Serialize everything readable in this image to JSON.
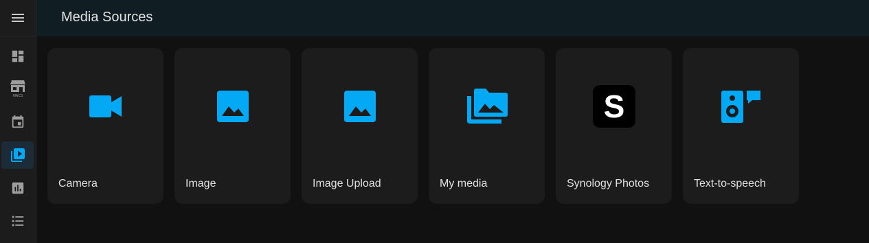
{
  "header": {
    "title": "Media Sources"
  },
  "sidebar": {
    "menu_icon": "menu-icon",
    "items": [
      {
        "icon": "dashboard-icon",
        "active": false
      },
      {
        "icon": "macs-store-icon",
        "active": false
      },
      {
        "icon": "calendar-icon",
        "active": false
      },
      {
        "icon": "media-browser-icon",
        "active": true
      },
      {
        "icon": "history-chart-icon",
        "active": false
      },
      {
        "icon": "list-icon",
        "active": false
      }
    ]
  },
  "colors": {
    "accent": "#03a9f4",
    "background": "#111111",
    "card": "#1c1c1c",
    "header": "#101e24",
    "text": "#e1e1e1",
    "sidebar_icon": "#9e9e9e"
  },
  "cards": [
    {
      "label": "Camera",
      "icon": "video-camera-icon"
    },
    {
      "label": "Image",
      "icon": "image-icon"
    },
    {
      "label": "Image Upload",
      "icon": "image-icon"
    },
    {
      "label": "My media",
      "icon": "image-multiple-icon"
    },
    {
      "label": "Synology Photos",
      "icon": "synology-s-logo"
    },
    {
      "label": "Text-to-speech",
      "icon": "speaker-message-icon"
    }
  ]
}
